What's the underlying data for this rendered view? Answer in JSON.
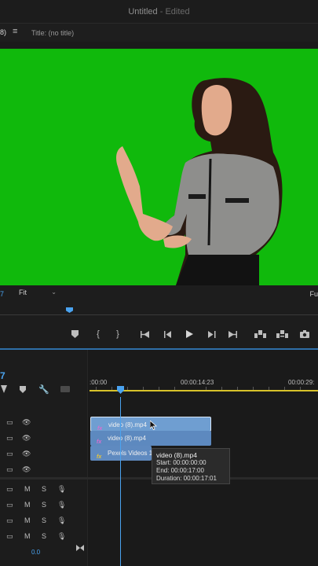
{
  "window": {
    "doc_title": "Untitled",
    "status": "- Edited"
  },
  "source_monitor": {
    "tab_label": "8)",
    "menu_icon": "hamburger-icon",
    "title": "Title: (no title)"
  },
  "program_monitor": {
    "timecode_fragment": "7",
    "zoom": "Fit",
    "resolution_fragment": "Fu",
    "footage_bg": "#0fb80b"
  },
  "transport": {
    "buttons": [
      "add-marker-icon",
      "mark-in-icon",
      "mark-out-icon",
      "go-to-in-icon",
      "step-back-icon",
      "play-icon",
      "step-forward-icon",
      "go-to-out-icon",
      "lift-icon",
      "extract-icon",
      "export-frame-icon"
    ]
  },
  "timeline": {
    "sequence_timecode_fragment": "7",
    "ruler_labels": [
      ":00:00",
      "00:00:14:23",
      "00:00:29:"
    ],
    "tools": [
      "snap-icon",
      "marker-icon",
      "wrench-icon",
      "captions-icon"
    ],
    "video_tracks": [
      {
        "name": "V4"
      },
      {
        "name": "V3"
      },
      {
        "name": "V2"
      },
      {
        "name": "V1"
      }
    ],
    "audio_tracks": [
      {
        "m": "M",
        "s": "S"
      },
      {
        "m": "M",
        "s": "S"
      },
      {
        "m": "M",
        "s": "S"
      },
      {
        "m": "M",
        "s": "S"
      }
    ],
    "clips": [
      {
        "fx": "fx",
        "label": "video (8).mp4"
      },
      {
        "fx": "fx",
        "label": "video (8).mp4"
      },
      {
        "fx": "fx",
        "label": "Pexels Videos 18"
      }
    ],
    "tooltip": {
      "name": "video (8).mp4",
      "start": "Start: 00:00:00:00",
      "end": "End: 00:00:17:00",
      "duration": "Duration: 00:00:17:01"
    },
    "master_volume": "0.0"
  },
  "colors": {
    "accent": "#4aa3f0",
    "work_area": "#d7c22a",
    "clip_video": "#6f9ed1"
  }
}
